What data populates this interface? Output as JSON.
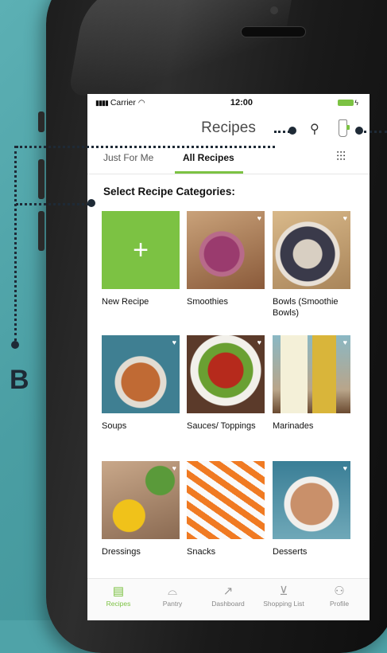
{
  "status_bar": {
    "carrier": "Carrier",
    "time": "12:00"
  },
  "header": {
    "title": "Recipes"
  },
  "tabs": [
    {
      "label": "Just For Me",
      "active": false
    },
    {
      "label": "All Recipes",
      "active": true
    }
  ],
  "section_title": "Select Recipe Categories:",
  "categories": [
    {
      "label": "New Recipe"
    },
    {
      "label": "Smoothies"
    },
    {
      "label": "Bowls (Smoothie Bowls)"
    },
    {
      "label": "Soups"
    },
    {
      "label": "Sauces/ Toppings"
    },
    {
      "label": "Marinades"
    },
    {
      "label": "Dressings"
    },
    {
      "label": "Snacks"
    },
    {
      "label": "Desserts"
    }
  ],
  "bottom_nav": [
    {
      "label": "Recipes",
      "icon": "recipes-icon",
      "active": true
    },
    {
      "label": "Pantry",
      "icon": "cloche-icon",
      "active": false
    },
    {
      "label": "Dashboard",
      "icon": "chart-icon",
      "active": false
    },
    {
      "label": "Shopping List",
      "icon": "cart-icon",
      "active": false
    },
    {
      "label": "Profile",
      "icon": "user-icon",
      "active": false
    }
  ],
  "annotation_label": "B",
  "colors": {
    "accent": "#7cc243",
    "background": "#4fa3a8",
    "annotation": "#1e2a36"
  }
}
